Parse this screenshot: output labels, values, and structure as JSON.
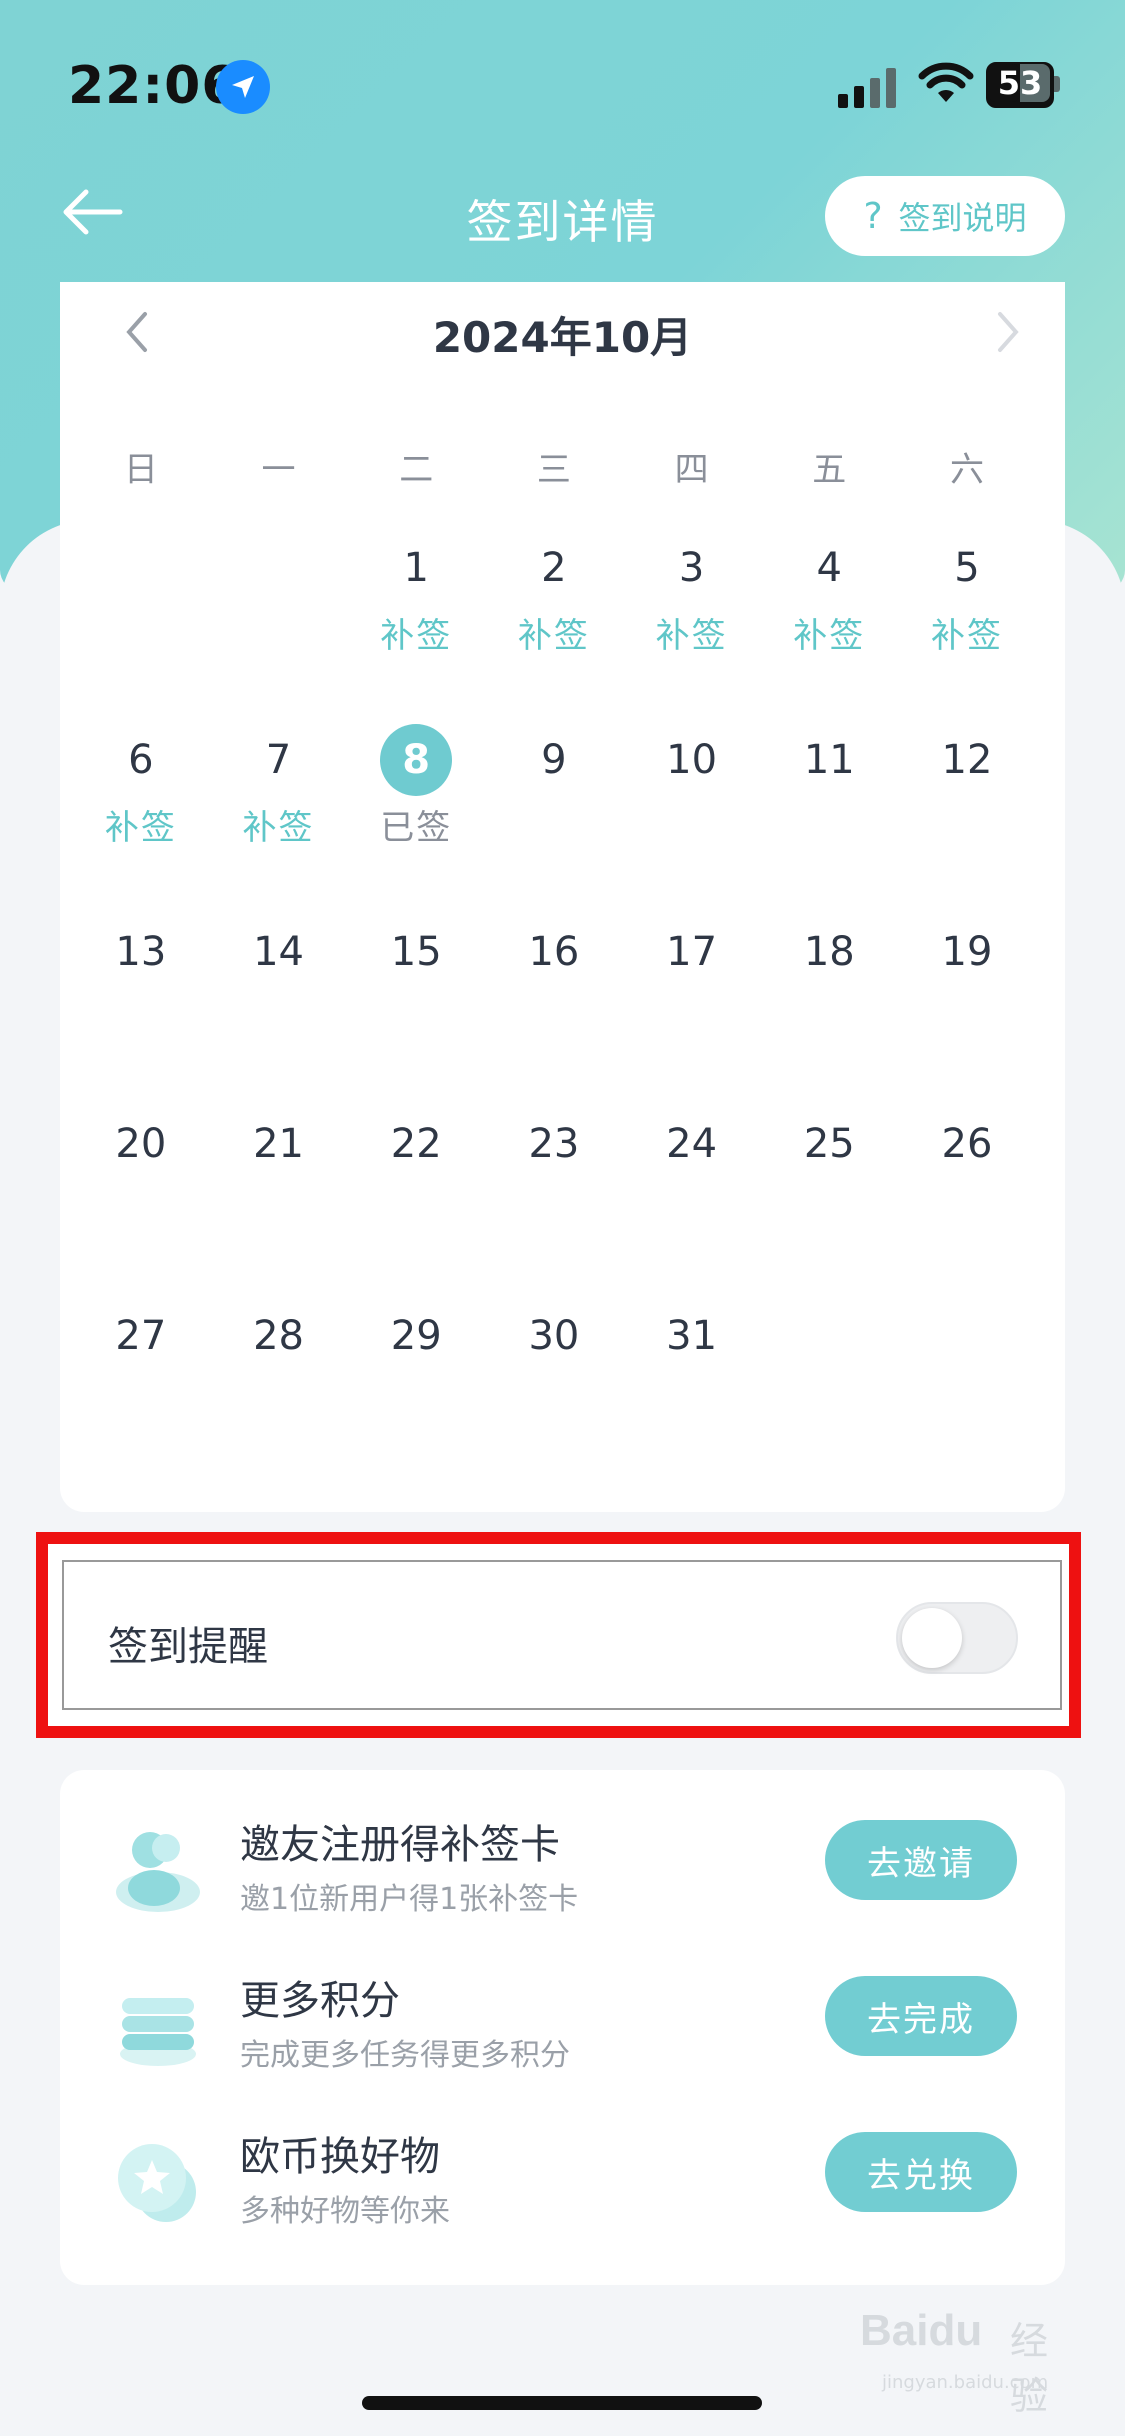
{
  "status_bar": {
    "time": "22:06",
    "battery": "53"
  },
  "nav": {
    "title": "签到详情",
    "help_label": "签到说明",
    "help_mark": "?"
  },
  "calendar": {
    "month": "2024年10月",
    "weekdays": [
      "日",
      "一",
      "二",
      "三",
      "四",
      "五",
      "六"
    ],
    "days": [
      {
        "num": "",
        "tag": ""
      },
      {
        "num": "",
        "tag": ""
      },
      {
        "num": "1",
        "tag": "补签"
      },
      {
        "num": "2",
        "tag": "补签"
      },
      {
        "num": "3",
        "tag": "补签"
      },
      {
        "num": "4",
        "tag": "补签"
      },
      {
        "num": "5",
        "tag": "补签"
      },
      {
        "num": "6",
        "tag": "补签"
      },
      {
        "num": "7",
        "tag": "补签"
      },
      {
        "num": "8",
        "tag": "已签",
        "signed": true
      },
      {
        "num": "9",
        "tag": ""
      },
      {
        "num": "10",
        "tag": ""
      },
      {
        "num": "11",
        "tag": ""
      },
      {
        "num": "12",
        "tag": ""
      },
      {
        "num": "13",
        "tag": ""
      },
      {
        "num": "14",
        "tag": ""
      },
      {
        "num": "15",
        "tag": ""
      },
      {
        "num": "16",
        "tag": ""
      },
      {
        "num": "17",
        "tag": ""
      },
      {
        "num": "18",
        "tag": ""
      },
      {
        "num": "19",
        "tag": ""
      },
      {
        "num": "20",
        "tag": ""
      },
      {
        "num": "21",
        "tag": ""
      },
      {
        "num": "22",
        "tag": ""
      },
      {
        "num": "23",
        "tag": ""
      },
      {
        "num": "24",
        "tag": ""
      },
      {
        "num": "25",
        "tag": ""
      },
      {
        "num": "26",
        "tag": ""
      },
      {
        "num": "27",
        "tag": ""
      },
      {
        "num": "28",
        "tag": ""
      },
      {
        "num": "29",
        "tag": ""
      },
      {
        "num": "30",
        "tag": ""
      },
      {
        "num": "31",
        "tag": ""
      }
    ]
  },
  "reminder": {
    "label": "签到提醒",
    "enabled": false
  },
  "tasks": [
    {
      "title": "邀友注册得补签卡",
      "subtitle": "邀1位新用户得1张补签卡",
      "button": "去邀请",
      "icon": "users-icon"
    },
    {
      "title": "更多积分",
      "subtitle": "完成更多任务得更多积分",
      "button": "去完成",
      "icon": "coins-stack-icon"
    },
    {
      "title": "欧币换好物",
      "subtitle": "多种好物等你来",
      "button": "去兑换",
      "icon": "star-coin-icon"
    }
  ],
  "watermark": {
    "brand": "Baidu",
    "brand_cn": "经验",
    "site": "jingyan.baidu.com"
  },
  "colors": {
    "accent": "#72cdd2",
    "hero": "#7fd3d4",
    "highlight_border": "#ee1111"
  }
}
